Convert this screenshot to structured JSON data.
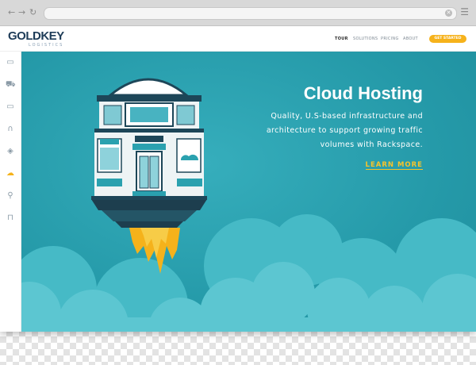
{
  "browser": {
    "back": "←",
    "forward": "→",
    "reload": "↻",
    "clear": "✕",
    "menu": "☰",
    "url": ""
  },
  "brand": {
    "name": "GOLDKEY",
    "tagline": "LOGISTICS"
  },
  "nav": {
    "items": [
      "TOUR",
      "SOLUTIONS",
      "PRICING",
      "ABOUT"
    ],
    "active": "TOUR",
    "cta": "GET STARTED"
  },
  "sidebar": {
    "icons": [
      {
        "name": "server-icon",
        "glyph": "▭"
      },
      {
        "name": "cart-icon",
        "glyph": "⛟"
      },
      {
        "name": "monitor-icon",
        "glyph": "▭"
      },
      {
        "name": "magnet-icon",
        "glyph": "∩"
      },
      {
        "name": "tag-icon",
        "glyph": "◈"
      },
      {
        "name": "cloud-icon",
        "glyph": "☁",
        "active": true
      },
      {
        "name": "user-search-icon",
        "glyph": "⚲"
      },
      {
        "name": "lock-icon",
        "glyph": "⊓"
      }
    ],
    "accent": "#f5b21b"
  },
  "hero": {
    "title": "Cloud Hosting",
    "lines": [
      "Quality, U.S-based infrastructure and",
      "architecture to support growing traffic",
      "volumes with Rackspace."
    ],
    "link": "LEARN MORE",
    "colors": {
      "background": "#259aa9",
      "accent": "#f7c32b",
      "building": "#1d4658"
    }
  }
}
